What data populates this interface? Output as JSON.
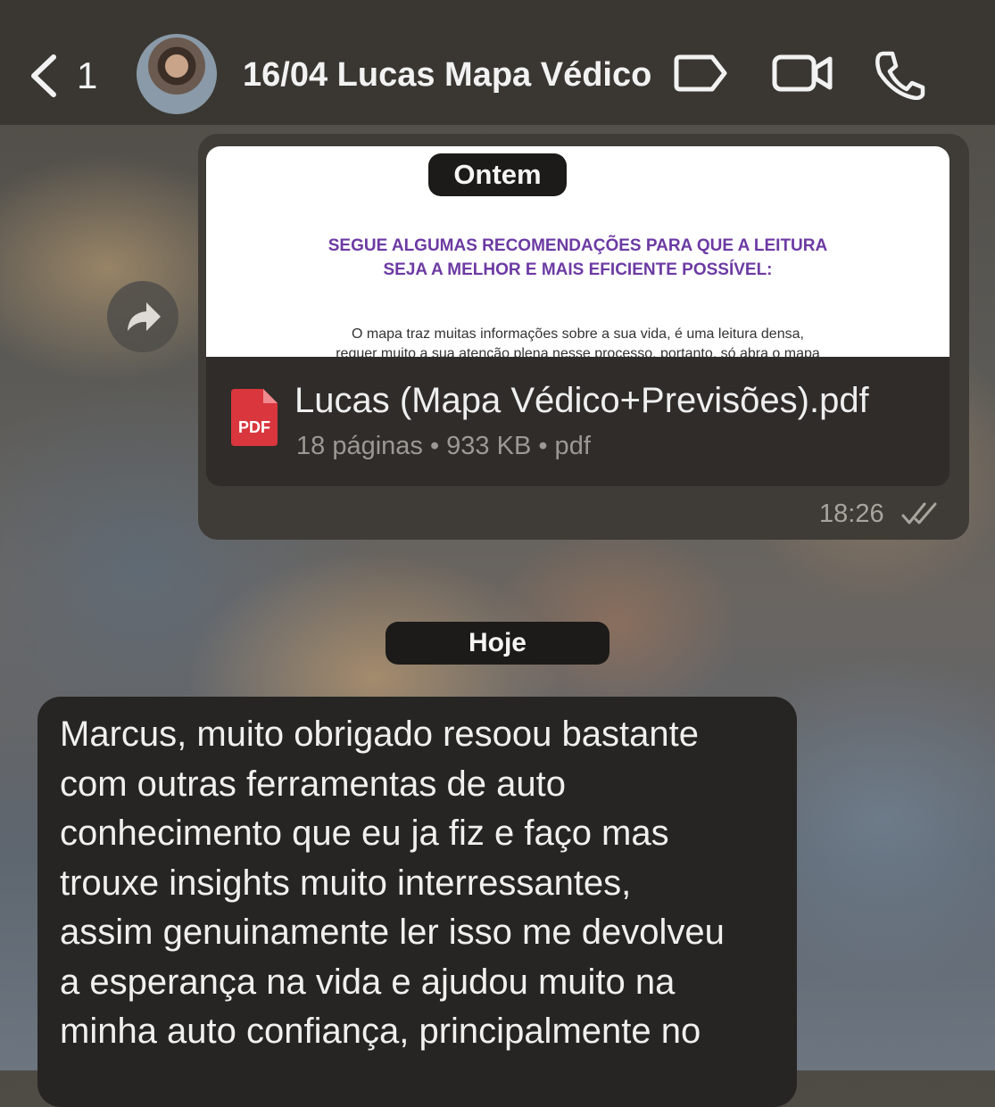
{
  "header": {
    "back_count": "1",
    "chat_title": "16/04 Lucas Mapa Védico",
    "icons": [
      "back-chevron-icon",
      "avatar",
      "label-tag-icon",
      "video-call-icon",
      "phone-call-icon"
    ]
  },
  "messages": {
    "date_yesterday": "Ontem",
    "date_today": "Hoje",
    "document": {
      "preview_heading_line1": "SEGUE ALGUMAS RECOMENDAÇÕES PARA QUE A LEITURA",
      "preview_heading_line2": "SEJA A MELHOR E MAIS EFICIENTE POSSÍVEL:",
      "preview_body_line1": "O mapa traz muitas informações sobre a sua vida, é uma leitura densa,",
      "preview_body_line2": "requer muito a sua atenção plena nesse processo, portanto, só abra o mapa",
      "file_name": "Lucas (Mapa Védico+Previsões).pdf",
      "file_meta": "18 páginas • 933 KB • pdf",
      "pdf_badge": "PDF",
      "time": "18:26",
      "status": "read-double-check"
    },
    "incoming_text": "Marcus, muito obrigado resoou bastante\ncom outras ferramentas de auto\nconhecimento que eu ja fiz e faço mas\ntrouxe insights muito interressantes,\nassim genuinamente ler isso me devolveu\na esperança na vida e ajudou muito na\nminha auto confiança, principalmente no"
  },
  "colors": {
    "header_bg": "#3a3732",
    "outgoing_bubble": "#3f3b36",
    "incoming_bubble": "#262523",
    "pdf_red": "#d9363e",
    "preview_purple": "#6c3aa3"
  }
}
